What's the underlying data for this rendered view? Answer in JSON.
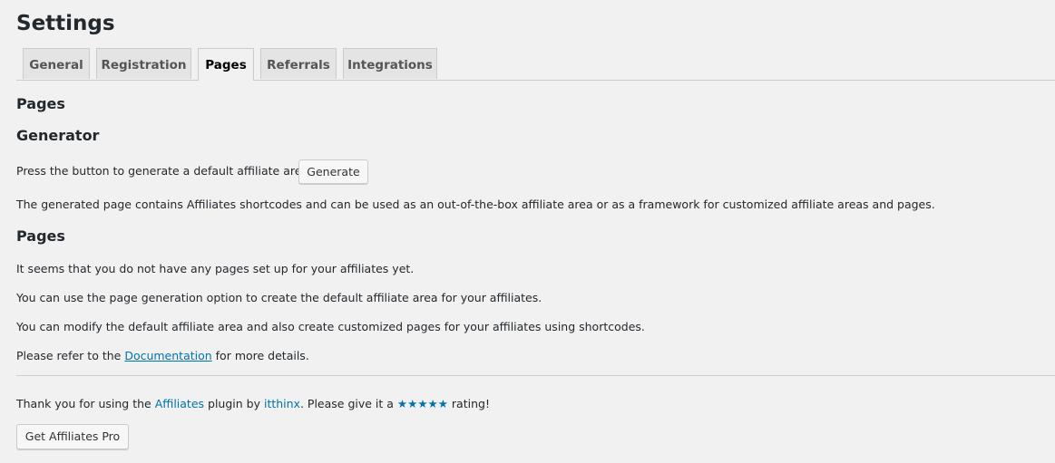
{
  "page": {
    "title": "Settings"
  },
  "tabs": [
    {
      "label": "General"
    },
    {
      "label": "Registration"
    },
    {
      "label": "Pages",
      "active": true
    },
    {
      "label": "Referrals"
    },
    {
      "label": "Integrations"
    }
  ],
  "content": {
    "heading_pages": "Pages",
    "generator": {
      "heading": "Generator",
      "instruction": "Press the button to generate a default affiliate area.",
      "button_label": "Generate",
      "description": "The generated page contains Affiliates shortcodes and can be used as an out-of-the-box affiliate area or as a framework for customized affiliate areas and pages."
    },
    "pages_section": {
      "heading": "Pages",
      "line1": "It seems that you do not have any pages set up for your affiliates yet.",
      "line2": "You can use the page generation option to create the default affiliate area for your affiliates.",
      "line3": "You can modify the default affiliate area and also create customized pages for your affiliates using shortcodes.",
      "refer_prefix": "Please refer to the ",
      "documentation_link": "Documentation",
      "refer_suffix": " for more details."
    }
  },
  "footer": {
    "thanks_prefix": "Thank you for using the ",
    "affiliates_link": "Affiliates",
    "plugin_by": " plugin by ",
    "author_link": "itthinx",
    "rating_prefix": ". Please give it a ",
    "stars": "★★★★★",
    "rating_suffix": " rating!",
    "pro_button_label": "Get Affiliates Pro"
  },
  "colors": {
    "background": "#f1f1f1",
    "link": "#0073aa",
    "text": "#23282d"
  }
}
